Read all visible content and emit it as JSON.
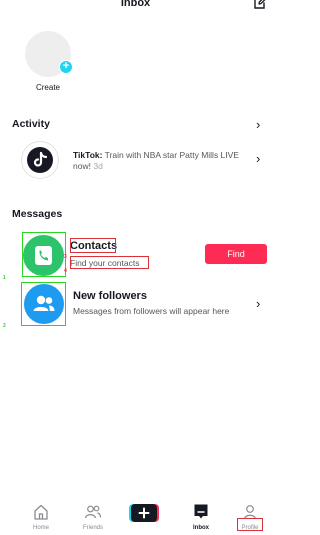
{
  "header": {
    "title": "Inbox"
  },
  "create": {
    "label": "Create"
  },
  "activity": {
    "title": "Activity",
    "item": {
      "sender": "TikTok:",
      "message": "Train with NBA star Patty Mills LIVE now!",
      "time": "3d"
    }
  },
  "messages": {
    "title": "Messages",
    "contacts": {
      "name": "Contacts",
      "subtitle": "Find your contacts",
      "button_label": "Find"
    },
    "new_followers": {
      "title": "New followers",
      "subtitle": "Messages from followers will appear here"
    }
  },
  "markers": {
    "m1": "1",
    "m2": "2",
    "m3": "3",
    "m4": "4"
  },
  "tabbar": {
    "items": [
      {
        "label": "Home",
        "icon": "home-icon"
      },
      {
        "label": "Friends",
        "icon": "friends-icon"
      },
      {
        "label": "",
        "icon": "create-plus-icon"
      },
      {
        "label": "Inbox",
        "icon": "inbox-icon"
      },
      {
        "label": "Profile",
        "icon": "profile-icon"
      }
    ],
    "active": "Inbox"
  },
  "colors": {
    "accent": "#fe2c55",
    "create_badge": "#20d5ec",
    "contacts": "#2dc36b",
    "followers": "#1d9bf0"
  }
}
